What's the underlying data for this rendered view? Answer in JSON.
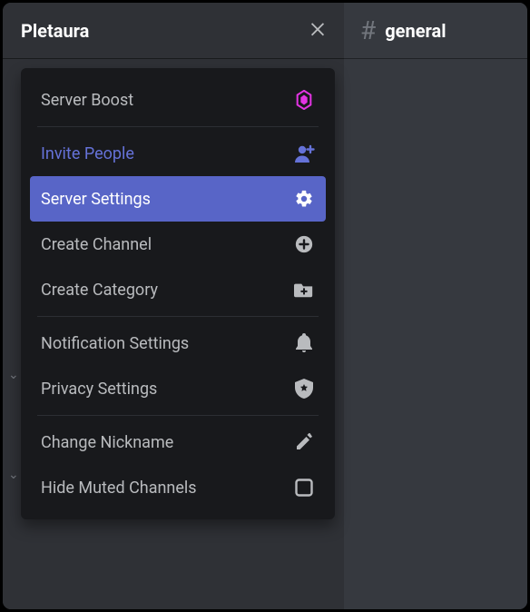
{
  "server": {
    "name": "Pletaura"
  },
  "channel": {
    "name": "general"
  },
  "menu": {
    "boost": "Server Boost",
    "invite": "Invite People",
    "settings": "Server Settings",
    "create_channel": "Create Channel",
    "create_category": "Create Category",
    "notification_settings": "Notification Settings",
    "privacy_settings": "Privacy Settings",
    "change_nickname": "Change Nickname",
    "hide_muted": "Hide Muted Channels"
  }
}
